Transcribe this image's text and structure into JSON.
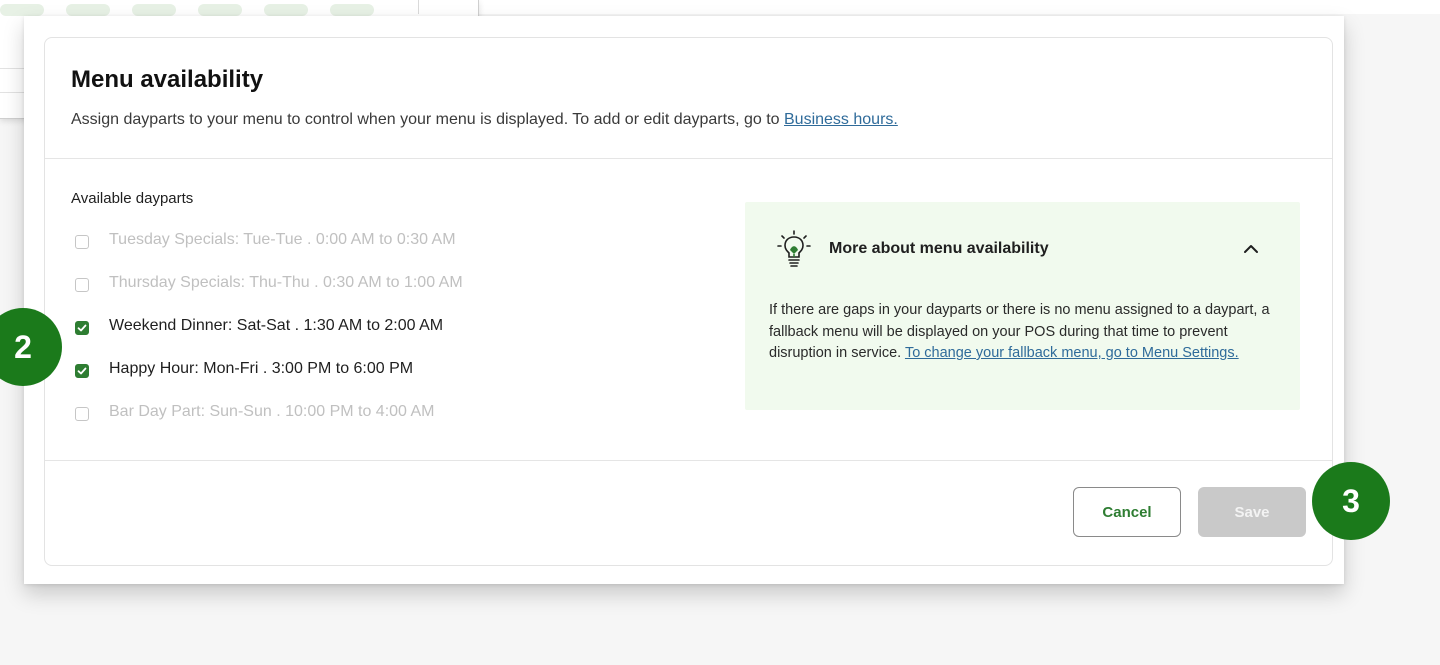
{
  "modal": {
    "title": "Menu availability",
    "subtitle": "Assign dayparts to your menu to control when your menu is displayed. To add or edit dayparts, go to",
    "subtitle_link": "Business hours."
  },
  "dayparts": {
    "label": "Available dayparts",
    "items": [
      {
        "label": "Tuesday Specials: Tue-Tue . 0:00 AM to 0:30 AM",
        "checked": false,
        "enabled": false
      },
      {
        "label": "Thursday Specials: Thu-Thu . 0:30 AM to 1:00 AM",
        "checked": false,
        "enabled": false
      },
      {
        "label": "Weekend Dinner: Sat-Sat . 1:30 AM to 2:00 AM",
        "checked": true,
        "enabled": true
      },
      {
        "label": "Happy Hour: Mon-Fri . 3:00 PM to 6:00 PM",
        "checked": true,
        "enabled": true
      },
      {
        "label": "Bar Day Part: Sun-Sun . 10:00 PM to 4:00 AM",
        "checked": false,
        "enabled": false
      }
    ]
  },
  "info": {
    "icon": "lightbulb-icon",
    "title": "More about menu availability",
    "body": "If there are gaps in your dayparts or there is no menu assigned to a daypart, a fallback menu will be displayed on your POS during that time to prevent disruption in service.",
    "link": "To change your fallback menu, go to Menu Settings."
  },
  "footer": {
    "cancel_label": "Cancel",
    "save_label": "Save"
  },
  "steps": {
    "step_2": "2",
    "step_3": "3"
  },
  "colors": {
    "accent": "#2e7d32",
    "badge": "#1b7a1b",
    "info_bg": "#f1faee",
    "link": "#2f6b9a"
  }
}
